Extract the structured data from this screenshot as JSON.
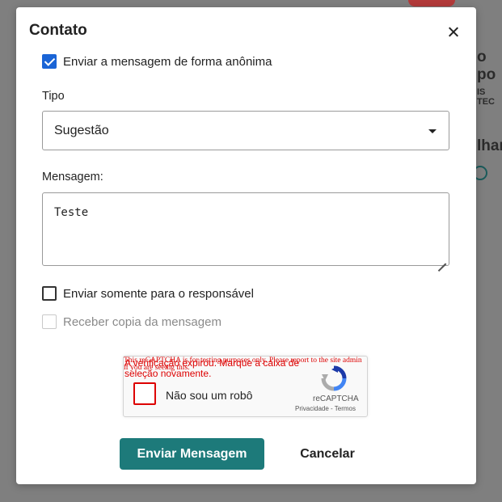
{
  "background": {
    "partial_text_1": "o po",
    "partial_text_2": "IS TEC",
    "partial_text_3": "lhar"
  },
  "modal": {
    "title": "Contato",
    "anonymous_label": "Enviar a mensagem de forma anônima",
    "anonymous_checked": true,
    "type": {
      "label": "Tipo",
      "selected": "Sugestão"
    },
    "message": {
      "label": "Mensagem:",
      "value": "Teste"
    },
    "only_responsible_label": "Enviar somente para o responsável",
    "copy_label": "Receber copia da mensagem",
    "recaptcha": {
      "error_admin": "This reCAPTCHA is for testing purposes only. Please report to the site admin if you are seeing this.",
      "error_expired": "A verificação expirou. Marque a caixa de seleção novamente.",
      "checkbox_label": "Não sou um robô",
      "brand": "reCAPTCHA",
      "links": "Privacidade - Termos"
    },
    "submit_label": "Enviar Mensagem",
    "cancel_label": "Cancelar"
  },
  "colors": {
    "accent": "#1d7a7a",
    "checkbox_checked": "#1a64d6",
    "error": "#dd0000"
  }
}
